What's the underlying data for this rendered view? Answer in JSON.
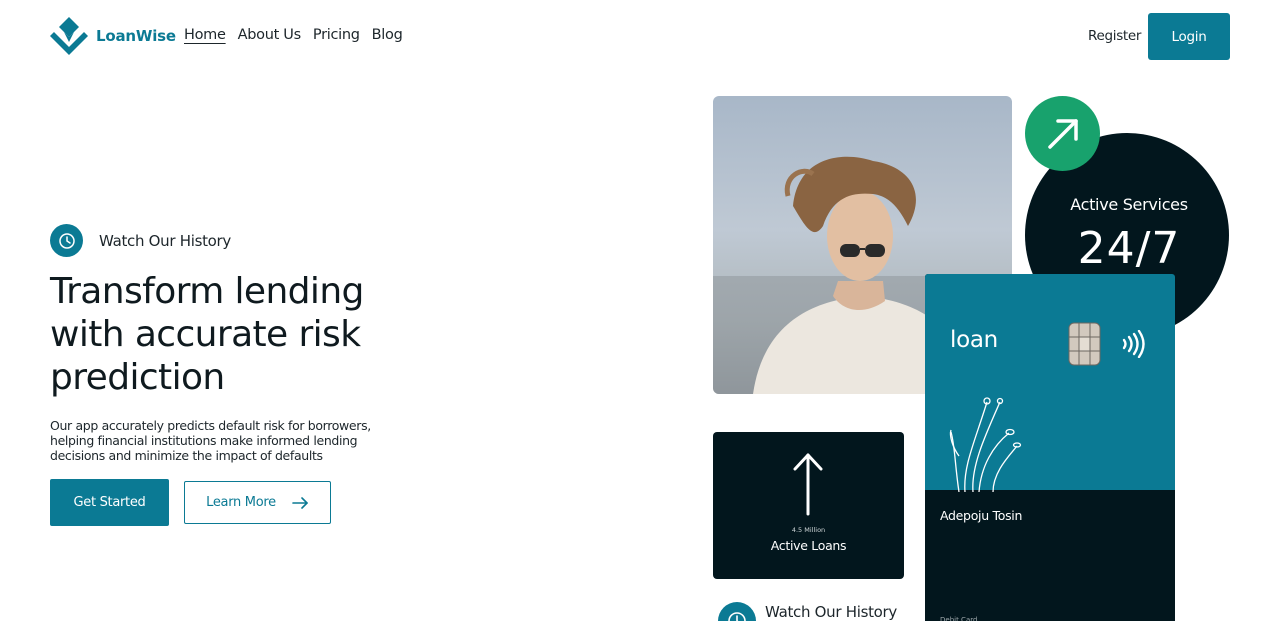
{
  "brand": {
    "name": "LoanWise",
    "color": "#0b7a94"
  },
  "nav": {
    "items": [
      "Home",
      "About Us",
      "Pricing",
      "Blog"
    ],
    "active": "Home"
  },
  "auth": {
    "register_label": "Register",
    "login_label": "Login"
  },
  "hero": {
    "history_label": "Watch Our History",
    "title": "Transform lending with accurate risk prediction",
    "description": "Our app accurately predicts default risk for borrowers, helping financial institutions make informed lending decisions and minimize the impact of defaults",
    "primary_button": "Get Started",
    "secondary_button": "Learn More"
  },
  "stats": {
    "services_label": "Active Services",
    "services_value": "24/7",
    "loans_sub": "4.5 Million",
    "loans_label": "Active Loans"
  },
  "card": {
    "title": "loan",
    "holder": "Adepoju Tosin",
    "type": "Debit Card"
  },
  "footer_peek": {
    "history_label": "Watch Our History"
  },
  "colors": {
    "accent": "#0b7a94",
    "dark": "#02161d",
    "green": "#18a26d"
  },
  "icons": {
    "logo": "diamond-logo-icon",
    "clock": "clock-icon",
    "arrow_right": "arrow-right-icon",
    "arrow_up_right": "arrow-up-right-icon",
    "arrow_up": "arrow-up-icon",
    "chip": "card-chip-icon",
    "nfc": "contactless-icon",
    "plant": "plant-icon"
  }
}
